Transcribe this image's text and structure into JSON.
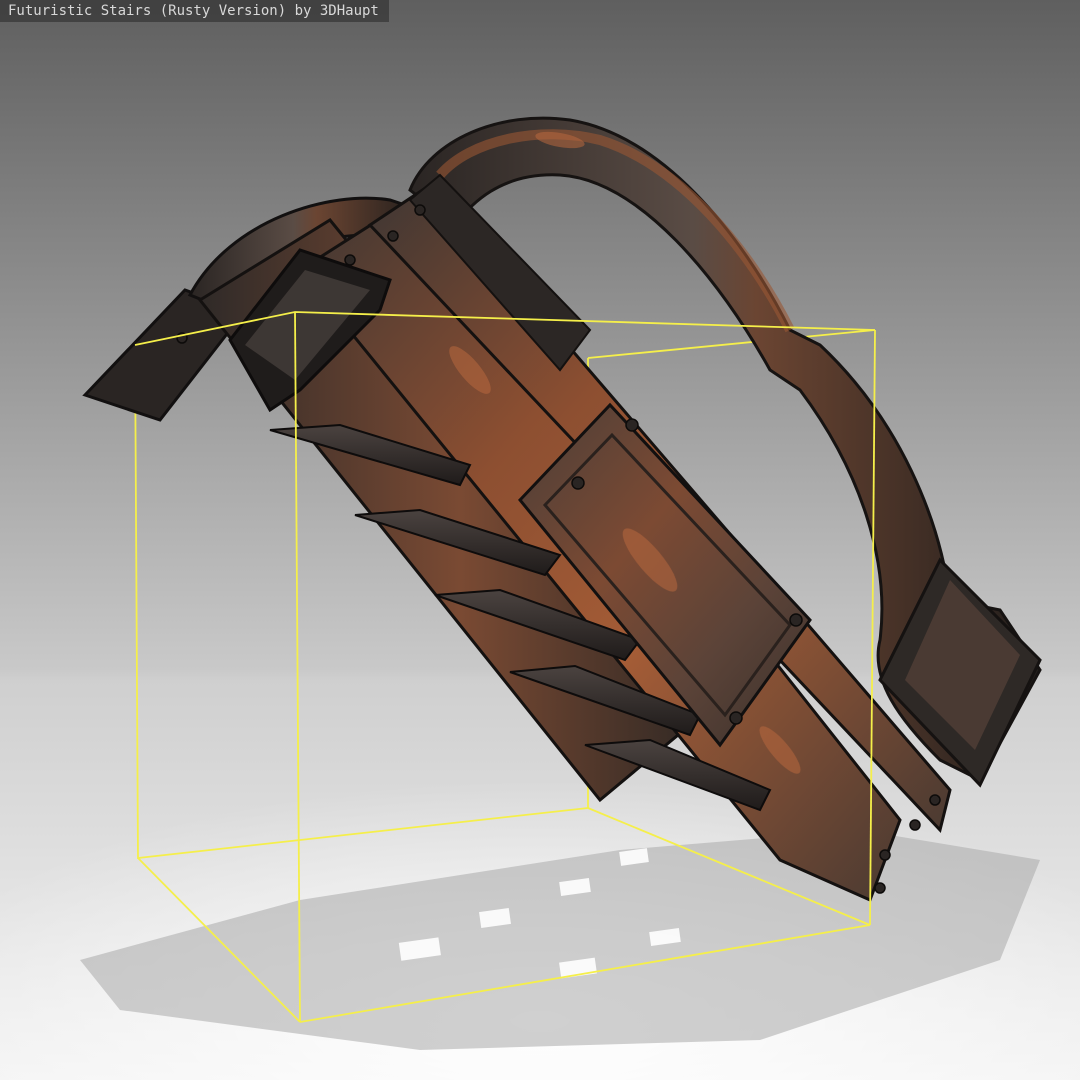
{
  "viewer": {
    "title": "Futuristic Stairs (Rusty Version) by 3DHaupt"
  },
  "scene": {
    "model": "futuristic-stairs-rusty",
    "selection_outline_color": "#f5ef4a",
    "rust_color": "#9a5634",
    "metal_color": "#3a3431",
    "background_top": "#6a6a6a",
    "floor_color": "#f0f0f0"
  }
}
